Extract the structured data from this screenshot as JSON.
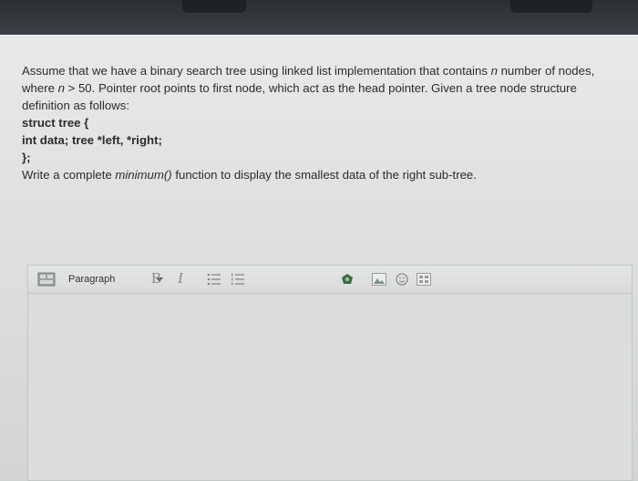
{
  "question": {
    "intro_part1": "Assume that we have a binary search tree using linked list implementation that contains ",
    "intro_var_n": "n",
    "intro_part2": " number of nodes,",
    "line2_part1": "where ",
    "line2_var_n": "n",
    "line2_part2": " > 50. Pointer root points to first node, which act as the head pointer. Given a tree node structure",
    "line3": "definition as follows:",
    "struct_open": "struct tree {",
    "struct_fields": "int data; tree *left, *right;",
    "struct_close": "};",
    "task_part1": "Write a complete ",
    "task_func": "minimum()",
    "task_part2": " function to display the smallest data of the right sub-tree."
  },
  "editor": {
    "paragraph_label": "Paragraph",
    "bold_label": "B",
    "italic_label": "I",
    "content": ""
  },
  "colors": {
    "text": "#2c2c30",
    "panel": "#e3e5e4",
    "bezel": "#2f3438"
  }
}
